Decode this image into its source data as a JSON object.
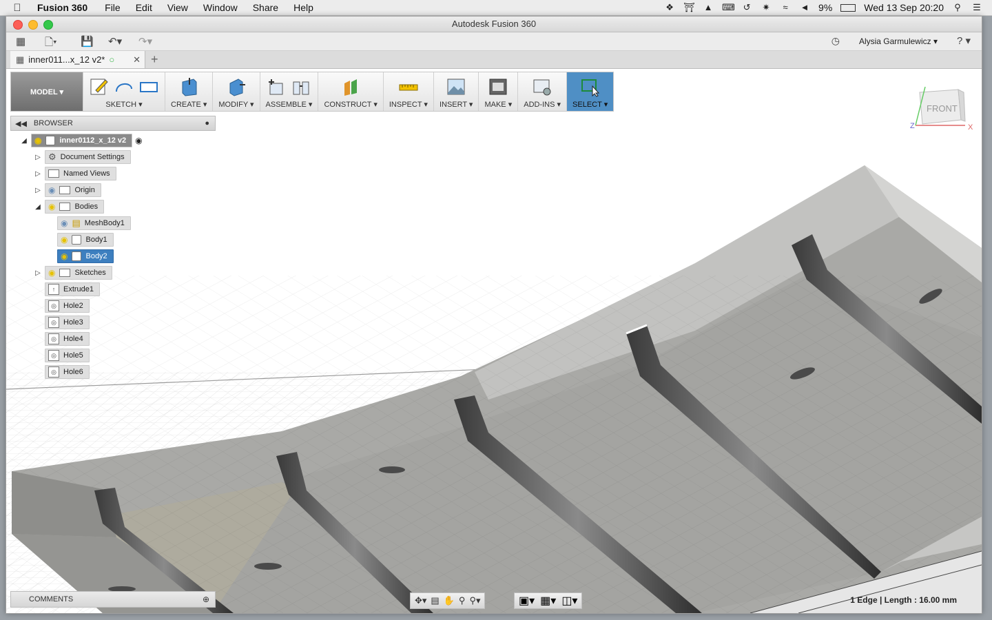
{
  "menubar": {
    "app_name": "Fusion 360",
    "items": [
      "File",
      "Edit",
      "View",
      "Window",
      "Share",
      "Help"
    ],
    "battery": "9%",
    "datetime": "Wed 13 Sep  20:20"
  },
  "window": {
    "title": "Autodesk Fusion 360"
  },
  "qat": {
    "user": "Alysia Garmulewicz ▾",
    "help": "? ▾"
  },
  "tab": {
    "name": "inner011...x_12 v2*"
  },
  "toolbar": {
    "workspace": "MODEL ▾",
    "groups": [
      {
        "label": "SKETCH ▾"
      },
      {
        "label": "CREATE ▾"
      },
      {
        "label": "MODIFY ▾"
      },
      {
        "label": "ASSEMBLE ▾"
      },
      {
        "label": "CONSTRUCT ▾"
      },
      {
        "label": "INSPECT ▾"
      },
      {
        "label": "INSERT ▾"
      },
      {
        "label": "MAKE ▾"
      },
      {
        "label": "ADD-INS ▾"
      },
      {
        "label": "SELECT ▾"
      }
    ]
  },
  "browser": {
    "title": "BROWSER",
    "root": "inner0112_x_12 v2",
    "items": [
      {
        "label": "Document Settings"
      },
      {
        "label": "Named Views"
      },
      {
        "label": "Origin"
      },
      {
        "label": "Bodies"
      },
      {
        "label": "MeshBody1"
      },
      {
        "label": "Body1"
      },
      {
        "label": "Body2"
      },
      {
        "label": "Sketches"
      }
    ],
    "history": [
      "Extrude1",
      "Hole2",
      "Hole3",
      "Hole4",
      "Hole5",
      "Hole6"
    ]
  },
  "comments": {
    "title": "COMMENTS"
  },
  "viewcube": {
    "face": "FRONT",
    "axis_x": "X",
    "axis_z": "Z"
  },
  "status": {
    "text": "1 Edge | Length : 16.00 mm"
  },
  "colors": {
    "select_blue": "#4f8fc5",
    "selection_blue": "#3d7fbf",
    "close_red": "#fc5f57",
    "minimize_yellow": "#fdbc2e",
    "zoom_green": "#34c84a"
  }
}
